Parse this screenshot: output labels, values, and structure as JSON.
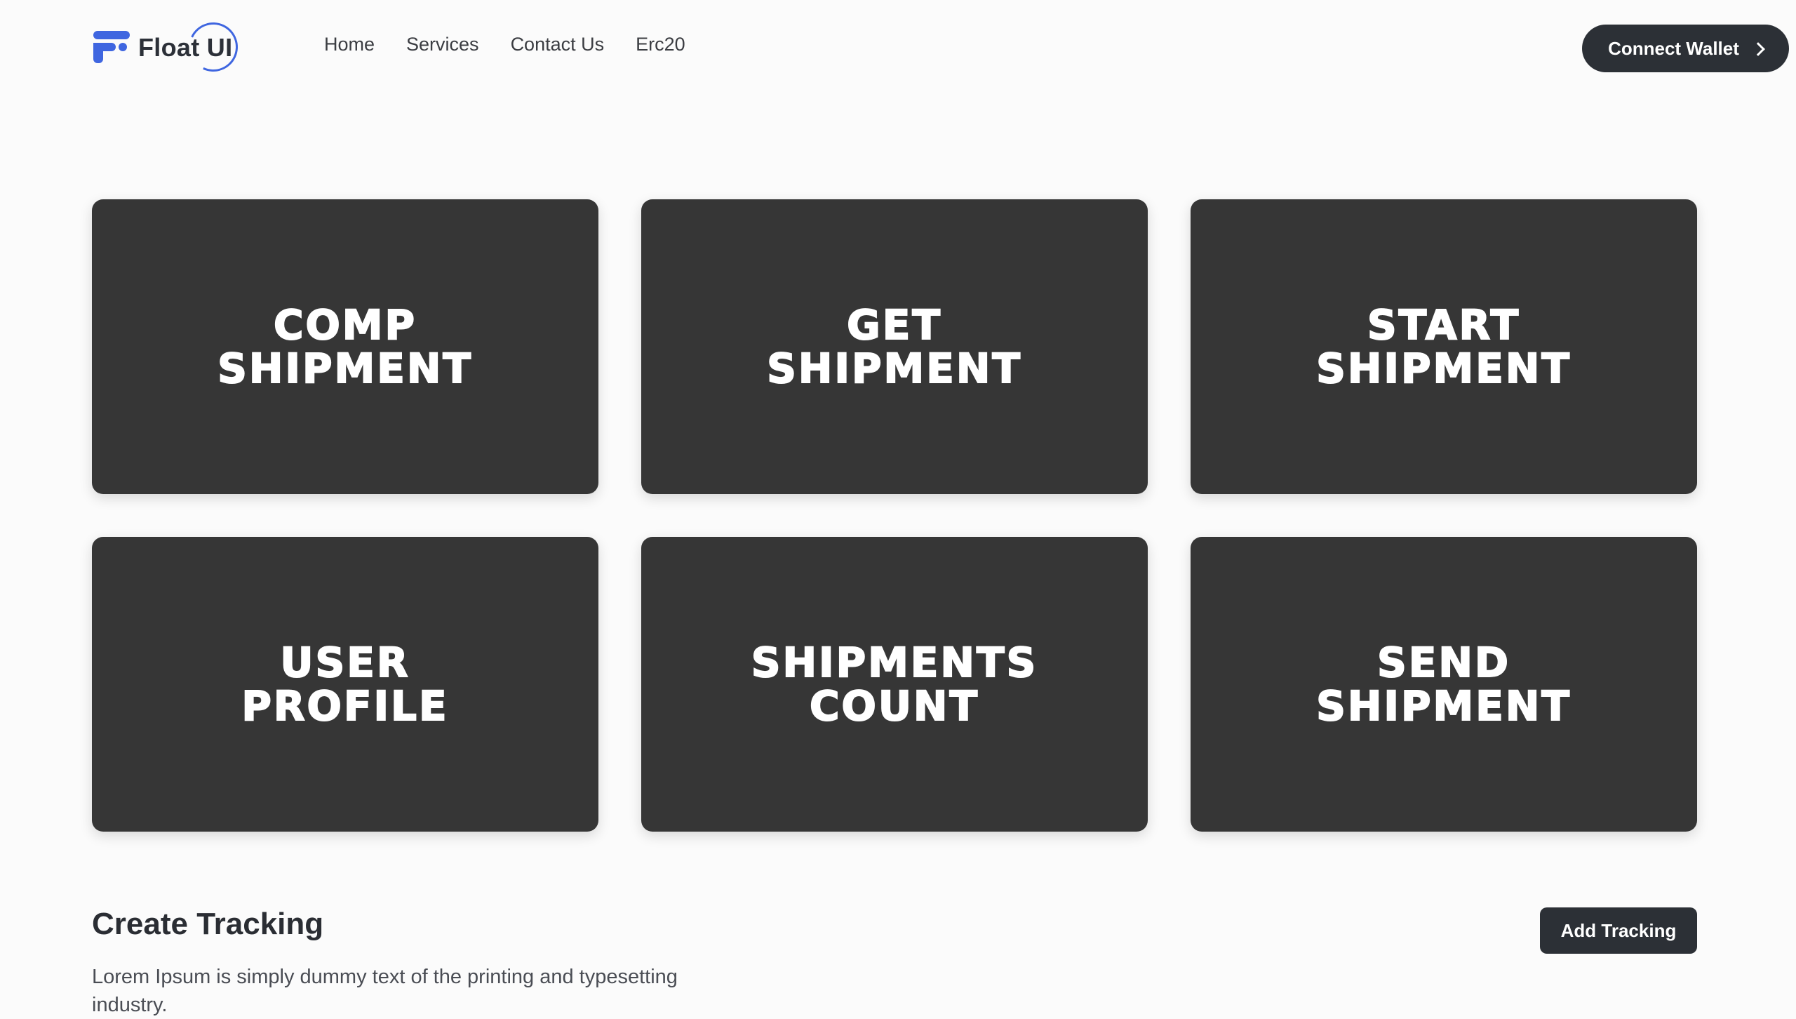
{
  "header": {
    "logo_text": "Float UI",
    "nav": [
      "Home",
      "Services",
      "Contact Us",
      "Erc20"
    ],
    "connect_label": "Connect Wallet"
  },
  "cards": [
    {
      "title": "COMP\nSHIPMENT"
    },
    {
      "title": "GET\nSHIPMENT"
    },
    {
      "title": "START\nSHIPMENT"
    },
    {
      "title": "USER\nPROFILE"
    },
    {
      "title": "SHIPMENTS\nCOUNT"
    },
    {
      "title": "SEND\nSHIPMENT"
    }
  ],
  "tracking": {
    "title": "Create Tracking",
    "description": "Lorem Ipsum is simply dummy text of the printing and typesetting industry.",
    "add_label": "Add Tracking"
  },
  "colors": {
    "accent": "#3f66e0",
    "card_bg": "#363636",
    "button_bg": "#2c3036",
    "page_bg": "#fbfbfb"
  }
}
